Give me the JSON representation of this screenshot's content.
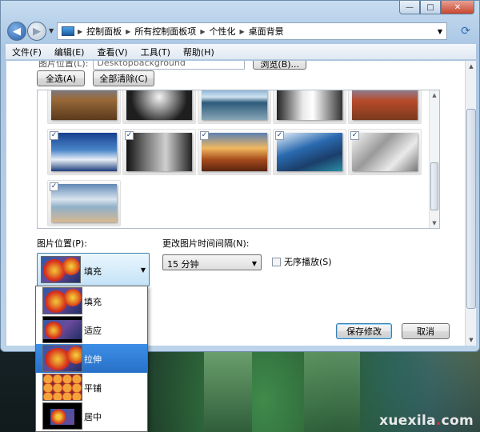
{
  "window": {
    "controls": {
      "minimize": "—",
      "maximize": "□",
      "close": "✕"
    }
  },
  "nav": {
    "back_icon": "◀",
    "forward_icon": "▶",
    "breadcrumbs": [
      "控制面板",
      "所有控制面板项",
      "个性化",
      "桌面背景"
    ]
  },
  "menu": [
    "文件(F)",
    "编辑(E)",
    "查看(V)",
    "工具(T)",
    "帮助(H)"
  ],
  "location": {
    "label": "图片位置(L):",
    "value": "Desktopbackground",
    "browse_label": "浏览(B)..."
  },
  "buttons": {
    "select_all": "全选(A)",
    "clear_all": "全部清除(C)",
    "save": "保存修改",
    "cancel": "取消"
  },
  "gallery": {
    "thumbnails": [
      {
        "name": "canyon",
        "checked": true
      },
      {
        "name": "bw-tree",
        "checked": true
      },
      {
        "name": "lake-mountain",
        "checked": true
      },
      {
        "name": "waterfall",
        "checked": true
      },
      {
        "name": "red-rock",
        "checked": true
      },
      {
        "name": "blue-mountains",
        "checked": true
      },
      {
        "name": "bw-forest",
        "checked": true
      },
      {
        "name": "sunset-field",
        "checked": true
      },
      {
        "name": "coast-tree",
        "checked": true
      },
      {
        "name": "snow-forest",
        "checked": true
      },
      {
        "name": "clouds-plain",
        "checked": true
      }
    ]
  },
  "position": {
    "label": "图片位置(P):",
    "selected": "填充",
    "options": [
      "填充",
      "适应",
      "拉伸",
      "平铺",
      "居中"
    ],
    "highlighted": "拉伸"
  },
  "interval": {
    "label": "更改图片时间间隔(N):",
    "value": "15 分钟"
  },
  "shuffle": {
    "label": "无序播放(S)",
    "checked": false
  },
  "watermark": {
    "text": "xuexila",
    "dot": ".",
    "suffix": "com"
  },
  "colors": {
    "selection": "#3079d0",
    "window_frame": "#b3cde8"
  }
}
